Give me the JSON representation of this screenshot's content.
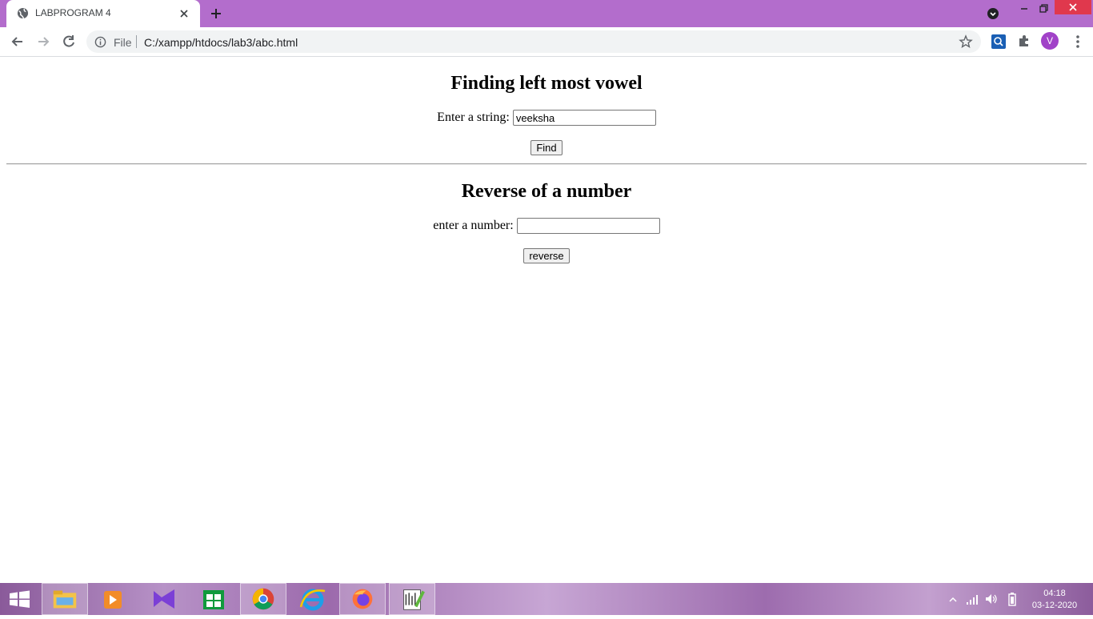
{
  "browser": {
    "tab_title": "LABPROGRAM 4",
    "omnibox_scheme_label": "File",
    "url": "C:/xampp/htdocs/lab3/abc.html",
    "profile_initial": "V"
  },
  "page": {
    "section1": {
      "heading": "Finding left most vowel",
      "label": "Enter a string:",
      "input_value": "veeksha",
      "button_label": "Find"
    },
    "section2": {
      "heading": "Reverse of a number",
      "label": "enter a number:",
      "input_value": "",
      "button_label": "reverse"
    }
  },
  "taskbar": {
    "time": "04:18",
    "date": "03-12-2020",
    "apps": [
      "start-icon",
      "file-explorer-icon",
      "media-player-icon",
      "visual-studio-icon",
      "store-icon",
      "chrome-icon",
      "internet-explorer-icon",
      "firefox-icon",
      "notepad-plus-icon"
    ]
  },
  "colors": {
    "titlebar": "#b36dcc",
    "close_button": "#e0384d",
    "avatar": "#a142c8"
  }
}
